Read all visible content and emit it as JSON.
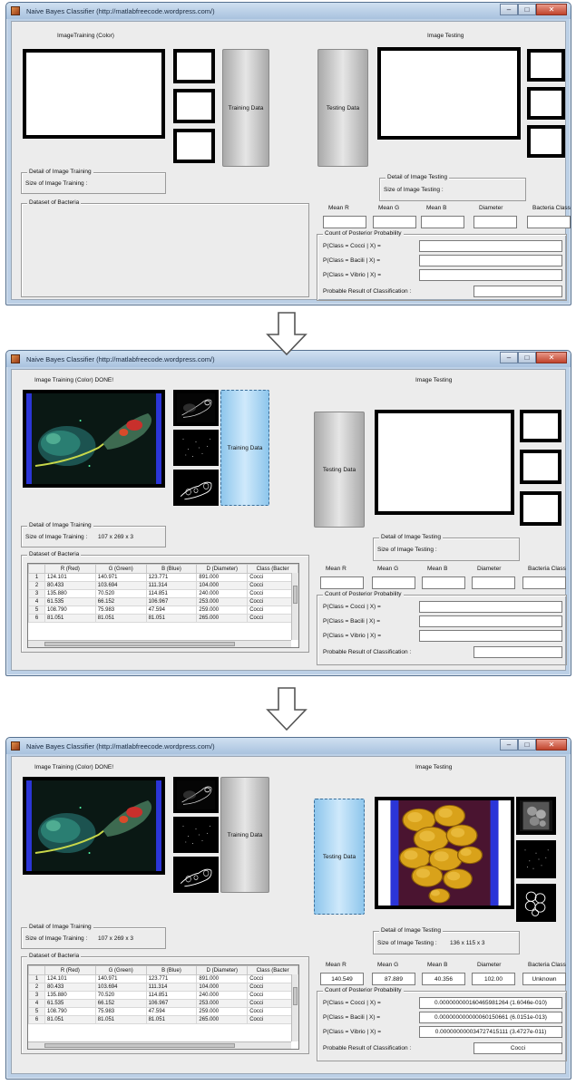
{
  "window_title": "Naive Bayes Classifier (http://matlabfreecode.wordpress.com/)",
  "window_buttons": {
    "minimize": "–",
    "maximize": "□",
    "close": "✕"
  },
  "arrow_icon": "down-arrow-icon",
  "screens": [
    {
      "training_title": "ImageTraining (Color)",
      "testing_title": "Image Testing",
      "training_button": "Training Data",
      "testing_button": "Testing Data",
      "detail_training": {
        "title": "Detail of Image Training",
        "label": "Size of Image Training :",
        "value": ""
      },
      "dataset_title": "Dataset of  Bacteria",
      "detail_testing": {
        "title": "Detail of Image Testing",
        "label": "Size of Image Testing :",
        "value": ""
      },
      "features": {
        "headers": [
          "Mean R",
          "Mean G",
          "Mean B",
          "Diameter",
          "Bacteria Class"
        ],
        "values": [
          "",
          "",
          "",
          "",
          ""
        ]
      },
      "posterior": {
        "title": "Count of  Posterior Probability",
        "labels": [
          "P(Class = Cocci | X) =",
          "P(Class = Bacili | X) =",
          "P(Class = Vibrio | X) ="
        ],
        "values": [
          "",
          "",
          ""
        ],
        "result_label": "Probable Result of Classification  :",
        "result_value": ""
      }
    },
    {
      "training_title": "Image Training (Color) DONE!",
      "testing_title": "Image Testing",
      "training_button": "Training Data",
      "testing_button": "Testing Data",
      "detail_training": {
        "title": "Detail of Image Training",
        "label": "Size of Image Training :",
        "value": "107 x 269 x 3"
      },
      "dataset_title": "Dataset of  Bacteria",
      "detail_testing": {
        "title": "Detail of Image Testing",
        "label": "Size of Image Testing :",
        "value": ""
      },
      "features": {
        "headers": [
          "Mean R",
          "Mean G",
          "Mean B",
          "Diameter",
          "Bacteria Class"
        ],
        "values": [
          "",
          "",
          "",
          "",
          ""
        ]
      },
      "posterior": {
        "title": "Count of  Posterior Probability",
        "labels": [
          "P(Class = Cocci | X) =",
          "P(Class = Bacili | X) =",
          "P(Class = Vibrio | X) ="
        ],
        "values": [
          "",
          "",
          ""
        ],
        "result_label": "Probable Result of Classification  :",
        "result_value": ""
      }
    },
    {
      "training_title": "Image Training (Color) DONE!",
      "testing_title": "Image Testing",
      "training_button": "Training Data",
      "testing_button": "Testing Data",
      "detail_training": {
        "title": "Detail of Image Training",
        "label": "Size of Image Training :",
        "value": "107 x 269 x 3"
      },
      "dataset_title": "Dataset of  Bacteria",
      "detail_testing": {
        "title": "Detail of Image Testing",
        "label": "Size of Image Testing :",
        "value": "136 x 115 x 3"
      },
      "features": {
        "headers": [
          "Mean R",
          "Mean G",
          "Mean B",
          "Diameter",
          "Bacteria Class"
        ],
        "values": [
          "140.549",
          "87.889",
          "40.356",
          "102.00",
          "Unknown"
        ]
      },
      "posterior": {
        "title": "Count of  Posterior Probability",
        "labels": [
          "P(Class = Cocci | X) =",
          "P(Class = Bacili | X) =",
          "P(Class = Vibrio | X) ="
        ],
        "values": [
          "0.000000000160465981264  (1.6046e-010)",
          "0.000000000000060150661  (6.0151e-013)",
          "0.000000000034727415111  (3.4727e-011)"
        ],
        "result_label": "Probable Result of Classification  :",
        "result_value": "Cocci"
      }
    }
  ],
  "dataset_table": {
    "columns": [
      "",
      "R (Red)",
      "G (Green)",
      "B (Blue)",
      "D (Diameter)",
      "Class (Bacter"
    ],
    "rows": [
      [
        "1",
        "124.101",
        "140.971",
        "123.771",
        "891.000",
        "Cocci"
      ],
      [
        "2",
        "80.433",
        "103.694",
        "111.314",
        "104.000",
        "Cocci"
      ],
      [
        "3",
        "135.880",
        "70.520",
        "114.851",
        "240.000",
        "Cocci"
      ],
      [
        "4",
        "61.535",
        "66.152",
        "106.967",
        "253.000",
        "Cocci"
      ],
      [
        "5",
        "108.790",
        "75.983",
        "47.594",
        "259.000",
        "Cocci"
      ],
      [
        "6",
        "81.051",
        "81.051",
        "81.051",
        "265.000",
        "Cocci"
      ]
    ]
  }
}
